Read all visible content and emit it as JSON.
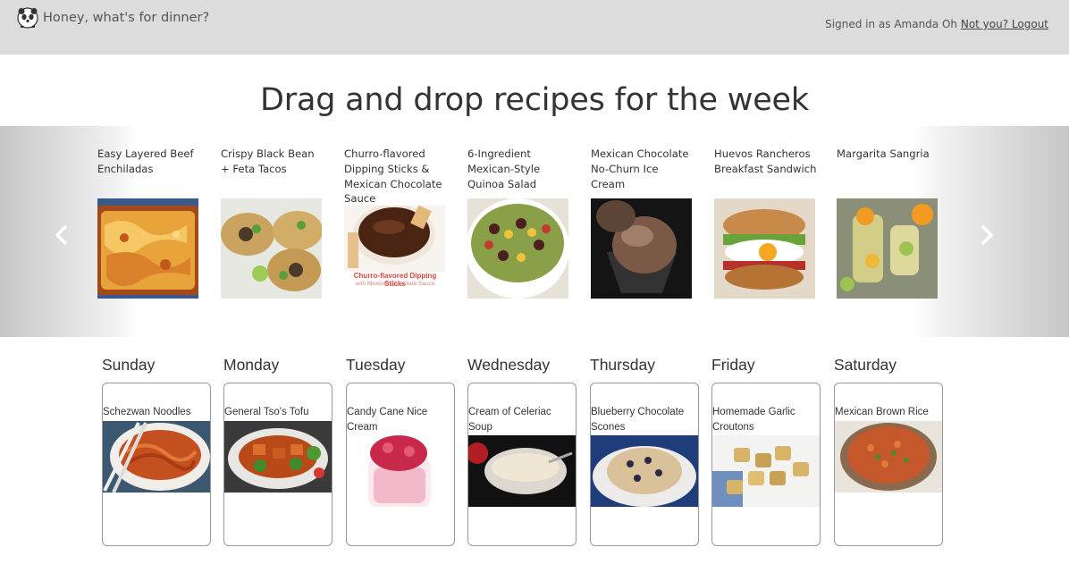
{
  "app": {
    "title": "Honey, what's for dinner?",
    "logo_icon": "panda-icon"
  },
  "account": {
    "signed_in_text": "Signed in as Amanda Oh",
    "logout_label": "Not you? Logout"
  },
  "heading": "Drag and drop recipes for the week",
  "carousel": {
    "prev_icon": "chevron-left-icon",
    "next_icon": "chevron-right-icon",
    "recipes": [
      {
        "name": "Easy Layered Beef Enchiladas"
      },
      {
        "name": "Crispy Black Bean + Feta Tacos"
      },
      {
        "name": "Churro-flavored Dipping Sticks & Mexican Chocolate Sauce",
        "image_caption_line1": "Churro-flavored Dipping Sticks",
        "image_caption_line2": "with Mexican Chocolate Sauce"
      },
      {
        "name": "6-Ingredient Mexican-Style Quinoa Salad"
      },
      {
        "name": "Mexican Chocolate No-Churn Ice Cream"
      },
      {
        "name": "Huevos Rancheros Breakfast Sandwich"
      },
      {
        "name": "Margarita Sangria"
      }
    ]
  },
  "week": [
    {
      "day": "Sunday",
      "recipe": "Schezwan Noodles"
    },
    {
      "day": "Monday",
      "recipe": "General Tso's Tofu"
    },
    {
      "day": "Tuesday",
      "recipe": "Candy Cane Nice Cream"
    },
    {
      "day": "Wednesday",
      "recipe": "Cream of Celeriac Soup"
    },
    {
      "day": "Thursday",
      "recipe": "Blueberry Chocolate Scones"
    },
    {
      "day": "Friday",
      "recipe": "Homemade Garlic Croutons"
    },
    {
      "day": "Saturday",
      "recipe": "Mexican Brown Rice"
    }
  ],
  "colors": {
    "topbar_bg": "#dcdcdc",
    "slot_border": "#999999",
    "text": "#333333"
  }
}
